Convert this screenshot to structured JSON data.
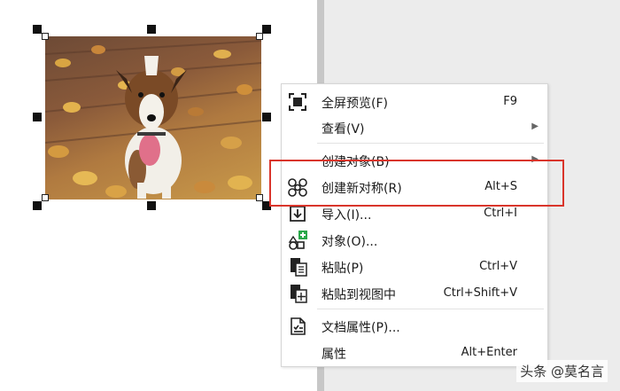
{
  "menu": {
    "items": [
      {
        "label": "全屏预览(F)",
        "shortcut": "F9",
        "icon": "fullscreen-icon"
      },
      {
        "label": "查看(V)",
        "shortcut": "",
        "submenu": true
      },
      {
        "label": "创建对象(B)",
        "shortcut": "",
        "submenu": true
      },
      {
        "label": "创建新对称(R)",
        "shortcut": "Alt+S",
        "icon": "symmetry-icon"
      },
      {
        "label": "导入(I)...",
        "shortcut": "Ctrl+I",
        "icon": "import-icon"
      },
      {
        "label": "对象(O)...",
        "shortcut": "",
        "icon": "object-icon"
      },
      {
        "label": "粘贴(P)",
        "shortcut": "Ctrl+V",
        "icon": "paste-icon"
      },
      {
        "label": "粘贴到视图中",
        "shortcut": "Ctrl+Shift+V",
        "icon": "paste-in-place-icon"
      },
      {
        "label": "文档属性(P)...",
        "shortcut": "",
        "icon": "document-properties-icon"
      },
      {
        "label": "属性",
        "shortcut": "Alt+Enter"
      }
    ]
  },
  "watermark": "头条 @莫名言",
  "colors": {
    "highlight": "#d9352b",
    "accent_green": "#2aa84a"
  }
}
